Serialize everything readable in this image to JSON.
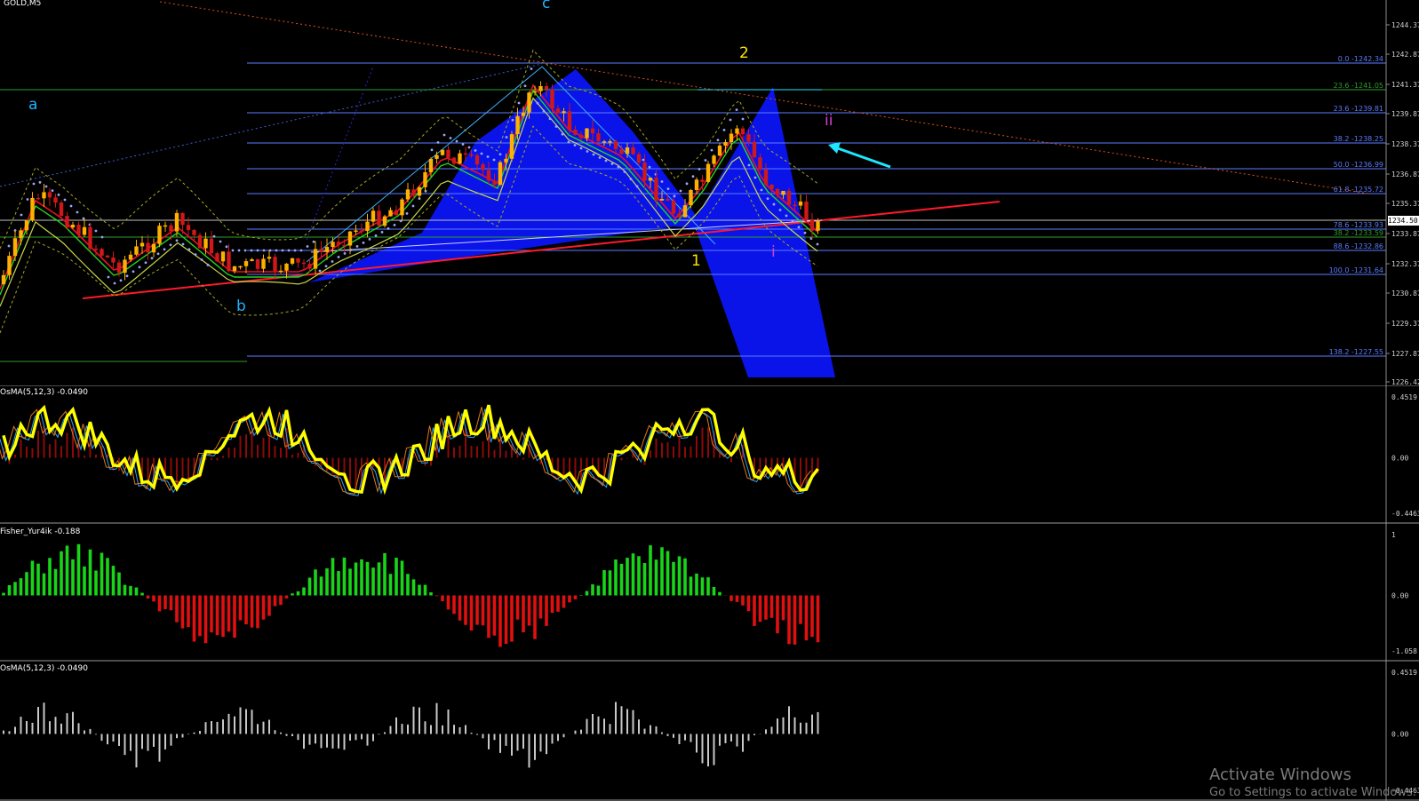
{
  "window": {
    "symbol_title": "GOLD,M5"
  },
  "main_chart": {
    "price_axis_labels": [
      "1244.37",
      "1242.87",
      "1241.37",
      "1239.87",
      "1238.37",
      "1236.87",
      "1235.37",
      "1233.87",
      "1232.37",
      "1230.87",
      "1229.37",
      "1227.87",
      "1226.42"
    ],
    "current_price": "1234.50",
    "fib_levels": [
      {
        "label": "0.0 -1242.34",
        "color": "#5b7bff"
      },
      {
        "label": "23.6 -1241.05",
        "color": "#2e9e2e"
      },
      {
        "label": "23.6 -1239.81",
        "color": "#5b7bff"
      },
      {
        "label": "38.2 -1238.25",
        "color": "#5b7bff"
      },
      {
        "label": "50.0 -1236.99",
        "color": "#5b7bff"
      },
      {
        "label": "61.8 -1235.72",
        "color": "#5b7bff"
      },
      {
        "label": "78.6 -1233.93",
        "color": "#5b7bff"
      },
      {
        "label": "38.2 -1233.59",
        "color": "#2e9e2e"
      },
      {
        "label": "88.6 -1232.86",
        "color": "#5b7bff"
      },
      {
        "label": "100.0 -1231.64",
        "color": "#5b7bff"
      },
      {
        "label": "138.2 -1227.55",
        "color": "#5b7bff"
      }
    ],
    "wave_labels": [
      {
        "text": "a",
        "color": "#1fb4ff"
      },
      {
        "text": "b",
        "color": "#1fb4ff"
      },
      {
        "text": "c",
        "color": "#1fb4ff"
      },
      {
        "text": "2",
        "color": "#ffe400"
      },
      {
        "text": "1",
        "color": "#ffe400"
      },
      {
        "text": "i",
        "color": "#d43fd4"
      },
      {
        "text": "ii",
        "color": "#d43fd4"
      }
    ]
  },
  "panel_osma_1": {
    "title": "OsMA(5,12,3) -0.0490",
    "axis_labels": [
      "0.4519",
      "0.00",
      "-0.4463"
    ]
  },
  "panel_fisher": {
    "title": "Fisher_Yur4ik -0.188",
    "axis_labels": [
      "1",
      "0.00",
      "-1.058"
    ]
  },
  "panel_osma_2": {
    "title": "OsMA(5,12,3) -0.0490",
    "axis_labels": [
      "0.4519",
      "0.00",
      "-0.4463"
    ]
  },
  "watermark": {
    "line1": "Activate Windows",
    "line2": "Go to Settings to activate Windows."
  },
  "colors": {
    "bull_candle": "#ffb000",
    "bear_candle": "#d01818",
    "fib_blue": "#5b7bff",
    "fib_green": "#2e9e2e",
    "pattern_fill": "#0a14e8",
    "osma_line": "#ffff00",
    "fisher_up": "#19d419",
    "fisher_down": "#e01010",
    "osma_hist_2": "#c8c8c8"
  }
}
